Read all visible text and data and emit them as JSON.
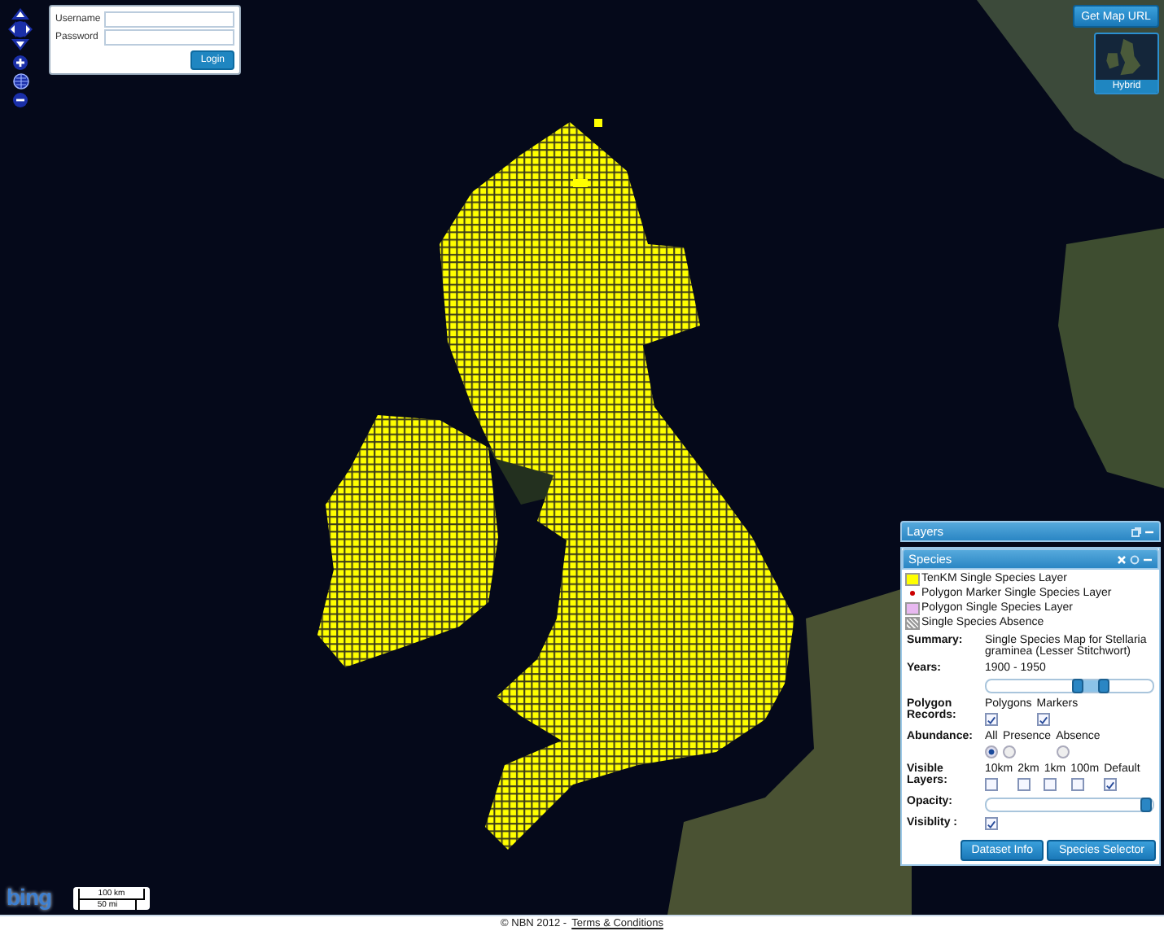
{
  "map": {
    "login": {
      "fields": [
        {
          "label": "Username"
        },
        {
          "label": "Password"
        }
      ],
      "button": "Login"
    },
    "get_map_url": "Get Map URL",
    "base_layer": {
      "label": "Hybrid"
    },
    "bing_logo": "bing",
    "scale": [
      "100 km",
      "50 mi"
    ]
  },
  "layers_panel": {
    "title": "Layers",
    "species": {
      "title": "Species",
      "legend": [
        {
          "kind": "square",
          "color": "#ffff00",
          "label": "TenKM Single Species Layer"
        },
        {
          "kind": "dot",
          "color": "#cc0000",
          "label": "Polygon Marker Single Species Layer"
        },
        {
          "kind": "square",
          "color": "#e8b8f0",
          "label": "Polygon Single Species Layer"
        },
        {
          "kind": "hatch",
          "color": "#999999",
          "label": "Single Species Absence"
        }
      ],
      "summary": {
        "label": "Summary:",
        "value": "Single Species Map for Stellaria graminea (Lesser Stitchwort)"
      },
      "years": {
        "label": "Years:",
        "value": "1900 - 1950",
        "thumbs": [
          {
            "level": 0.55
          },
          {
            "level": 0.71
          }
        ]
      },
      "polygon_records": {
        "label": "Polygon Records:",
        "options": [
          {
            "label": "Polygons",
            "checked": true
          },
          {
            "label": "Markers",
            "checked": true
          }
        ]
      },
      "abundance": {
        "label": "Abundance:",
        "options": [
          {
            "label": "All",
            "selected": true
          },
          {
            "label": "Presence",
            "selected": false
          },
          {
            "label": "Absence",
            "selected": false
          }
        ]
      },
      "visible_layers": {
        "label": "Visible Layers:",
        "options": [
          {
            "label": "10km",
            "checked": false
          },
          {
            "label": "2km",
            "checked": false
          },
          {
            "label": "1km",
            "checked": false
          },
          {
            "label": "100m",
            "checked": false
          },
          {
            "label": "Default",
            "checked": true
          }
        ]
      },
      "opacity": {
        "label": "Opacity:",
        "level": 1.0
      },
      "visibility": {
        "label": "Visiblity :",
        "checked": true
      },
      "buttons": [
        "Dataset Info",
        "Species Selector"
      ]
    }
  },
  "footer": {
    "copyright": "© NBN 2012 -",
    "link": "Terms & Conditions"
  }
}
